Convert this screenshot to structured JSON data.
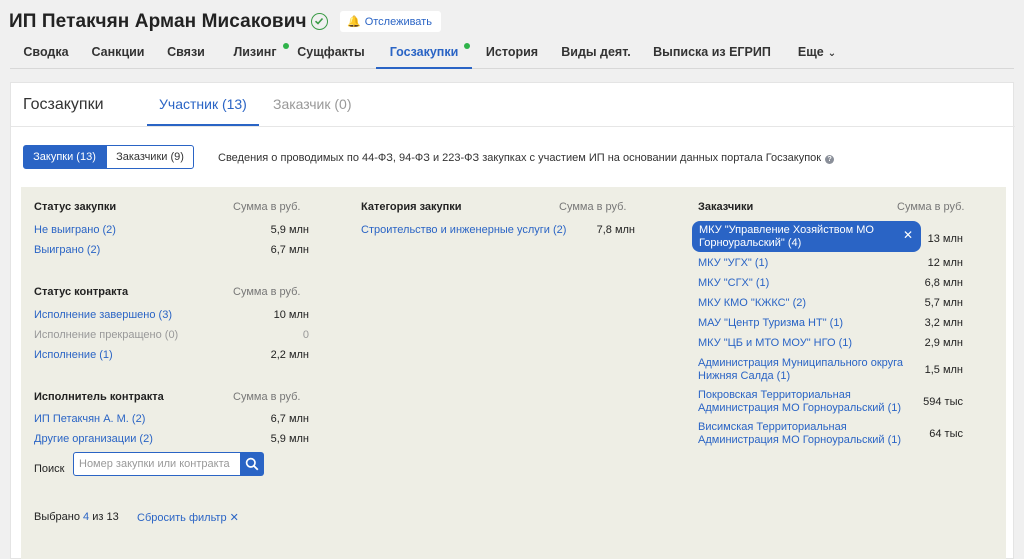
{
  "header": {
    "title": "ИП Петакчян Арман Мисакович",
    "track_label": "Отслеживать"
  },
  "tabs": [
    {
      "label": "Сводка"
    },
    {
      "label": "Санкции"
    },
    {
      "label": "Связи"
    },
    {
      "label": "Лизинг",
      "dot": true
    },
    {
      "label": "Сущфакты"
    },
    {
      "label": "Госзакупки",
      "dot": true,
      "active": true
    },
    {
      "label": "История"
    },
    {
      "label": "Виды деят."
    },
    {
      "label": "Выписка из ЕГРИП"
    },
    {
      "label": "Еще"
    }
  ],
  "card": {
    "title": "Госзакупки",
    "subtab_active": "Участник (13)",
    "subtab_inactive": "Заказчик (0)",
    "seg_on": "Закупки (13)",
    "seg_off": "Заказчики (9)",
    "info": "Сведения о проводимых по 44-ФЗ, 94-ФЗ и 223-ФЗ закупках с участием ИП на основании данных портала Госзакупок"
  },
  "sum_header": "Сумма в руб.",
  "status": {
    "title": "Статус закупки",
    "rows": [
      {
        "label": "Не выиграно (2)",
        "value": "5,9 млн"
      },
      {
        "label": "Выиграно (2)",
        "value": "6,7 млн"
      }
    ]
  },
  "contract_status": {
    "title": "Статус контракта",
    "rows": [
      {
        "label": "Исполнение завершено (3)",
        "value": "10 млн"
      },
      {
        "label": "Исполнение прекращено (0)",
        "value": "0"
      },
      {
        "label": "Исполнение (1)",
        "value": "2,2 млн"
      }
    ]
  },
  "executor": {
    "title": "Исполнитель контракта",
    "rows": [
      {
        "label": "ИП Петакчян А. М. (2)",
        "value": "6,7 млн"
      },
      {
        "label": "Другие организации (2)",
        "value": "5,9 млн"
      }
    ]
  },
  "category": {
    "title": "Категория закупки",
    "rows": [
      {
        "label": "Строительство и инженерные услуги (2)",
        "value": "7,8 млн"
      }
    ]
  },
  "customers": {
    "title": "Заказчики",
    "selected": {
      "label_1": "МКУ \"Управление Хозяйством МО",
      "label_2": "Горноуральский\" (4)",
      "value": "13 млн"
    },
    "rows": [
      {
        "label_1": "МКУ \"УГХ\" (1)",
        "label_2": "",
        "value": "12 млн"
      },
      {
        "label_1": "МКУ \"СГХ\" (1)",
        "label_2": "",
        "value": "6,8 млн"
      },
      {
        "label_1": "МКУ КМО \"КЖКС\" (2)",
        "label_2": "",
        "value": "5,7 млн"
      },
      {
        "label_1": "МАУ \"Центр Туризма НТ\" (1)",
        "label_2": "",
        "value": "3,2 млн"
      },
      {
        "label_1": "МКУ \"ЦБ и МТО МОУ\" НГО (1)",
        "label_2": "",
        "value": "2,9 млн"
      },
      {
        "label_1": "Администрация Муниципального округа",
        "label_2": "Нижняя Салда (1)",
        "value": "1,5 млн"
      },
      {
        "label_1": "Покровская Территориальная",
        "label_2": "Администрация МО Горноуральский (1)",
        "value": "594 тыс"
      },
      {
        "label_1": "Висимская Территориальная",
        "label_2": "Администрация МО Горноуральский (1)",
        "value": "64 тыс"
      }
    ]
  },
  "search": {
    "label": "Поиск",
    "placeholder": "Номер закупки или контракта"
  },
  "footer": {
    "selected_prefix": "Выбрано",
    "selected_count": "4",
    "selected_suffix": "из 13",
    "reset_label": "Сбросить фильтр"
  },
  "colors": {
    "accent": "#2a64c5",
    "dot": "#2fb34a",
    "filter_bg": "#eeeee5"
  }
}
